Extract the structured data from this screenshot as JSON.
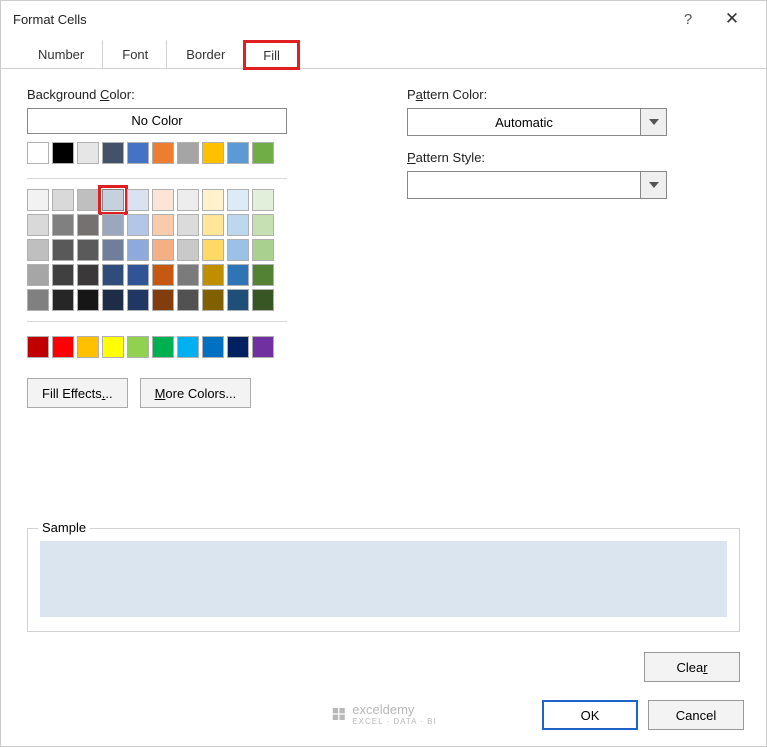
{
  "title": "Format Cells",
  "tabs": {
    "number": "Number",
    "font": "Font",
    "border": "Border",
    "fill": "Fill"
  },
  "labels": {
    "bg_color": "Background Color:",
    "pattern_color": "Pattern Color:",
    "pattern_style": "Pattern Style:",
    "sample": "Sample",
    "no_color": "No Color",
    "fill_effects": "Fill Effects...",
    "more_colors": "More Colors...",
    "automatic": "Automatic",
    "clear": "Clear",
    "ok": "OK",
    "cancel": "Cancel"
  },
  "colors": {
    "row0": [
      "#ffffff",
      "#000000",
      "#e7e6e6",
      "#435169",
      "#4472c4",
      "#ed7d31",
      "#a5a5a5",
      "#ffc000",
      "#5b9bd5",
      "#70ad47"
    ],
    "matrix": [
      [
        "#f2f2f2",
        "#d9d9d9",
        "#bfbfbf",
        "#c6d1de",
        "#d9e1f2",
        "#fce4d6",
        "#ededed",
        "#fff2cc",
        "#ddebf7",
        "#e2efda"
      ],
      [
        "#d9d9d9",
        "#808080",
        "#757171",
        "#9ba7bc",
        "#b4c6e7",
        "#f8cbad",
        "#dbdbdb",
        "#ffe699",
        "#bdd7ee",
        "#c6e0b4"
      ],
      [
        "#bfbfbf",
        "#595959",
        "#5a5a5a",
        "#6f7e9a",
        "#8ea9db",
        "#f4b084",
        "#c9c9c9",
        "#ffd966",
        "#9bc2e6",
        "#a9d08e"
      ],
      [
        "#a6a6a6",
        "#404040",
        "#3a3838",
        "#2f4c7a",
        "#305496",
        "#c65911",
        "#7b7b7b",
        "#bf8f00",
        "#2f75b5",
        "#548235"
      ],
      [
        "#808080",
        "#262626",
        "#161616",
        "#1e2d47",
        "#203764",
        "#833c0c",
        "#525252",
        "#806000",
        "#1f4e78",
        "#375623"
      ]
    ],
    "standard": [
      "#c00000",
      "#ff0000",
      "#ffc000",
      "#ffff00",
      "#92d050",
      "#00b050",
      "#00b0f0",
      "#0070c0",
      "#002060",
      "#7030a0"
    ]
  },
  "selected_swatch": {
    "row": 0,
    "col": 3
  },
  "sample_color": "#dbe5ef",
  "watermark": {
    "brand": "exceldemy",
    "sub": "EXCEL · DATA · BI"
  }
}
